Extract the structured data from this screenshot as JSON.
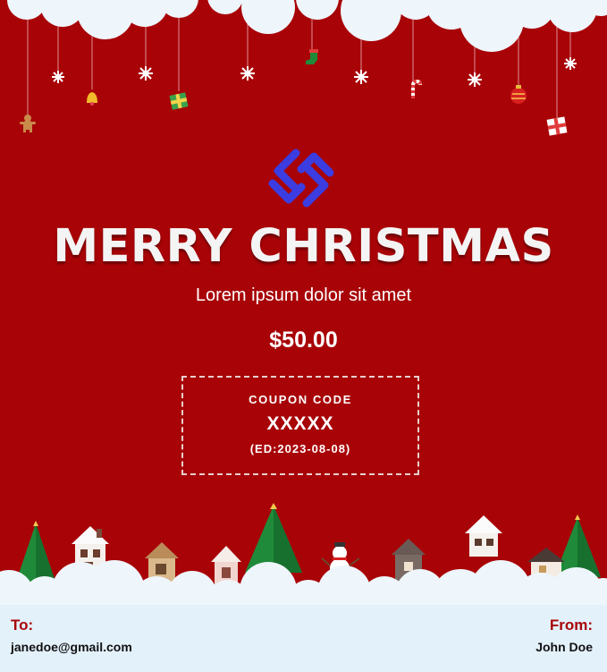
{
  "card": {
    "title": "MERRY CHRISTMAS",
    "subtitle": "Lorem ipsum dolor sit amet",
    "amount": "$50.00",
    "coupon": {
      "label": "COUPON CODE",
      "code": "XXXXX",
      "expiry": "(ED:2023-08-08)"
    }
  },
  "footer": {
    "to_label": "To:",
    "to_value": "janedoe@gmail.com",
    "from_label": "From:",
    "from_value": "John Doe"
  },
  "colors": {
    "background_red": "#a80307",
    "footer_bg": "#e3f1fb",
    "label_red": "#a80307",
    "logo_blue": "#3b3de0",
    "tree_green": "#1f8a3a"
  },
  "icons": [
    "logo-icon",
    "snowflake-icon",
    "gingerbread-icon",
    "bell-icon",
    "gift-icon",
    "stocking-icon",
    "candy-cane-icon",
    "ornament-ball-icon",
    "christmas-tree-icon",
    "house-icon",
    "snowman-icon"
  ]
}
